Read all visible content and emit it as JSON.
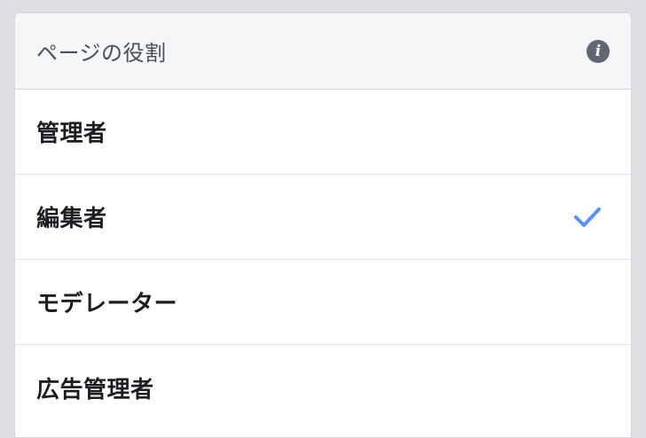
{
  "header": {
    "title": "ページの役割",
    "info_icon": "info-icon"
  },
  "roles": [
    {
      "label": "管理者",
      "selected": false
    },
    {
      "label": "編集者",
      "selected": true
    },
    {
      "label": "モデレーター",
      "selected": false
    },
    {
      "label": "広告管理者",
      "selected": false
    }
  ],
  "colors": {
    "accent": "#5890ff",
    "background": "#dddfe2",
    "header_bg": "#f5f6f7"
  }
}
